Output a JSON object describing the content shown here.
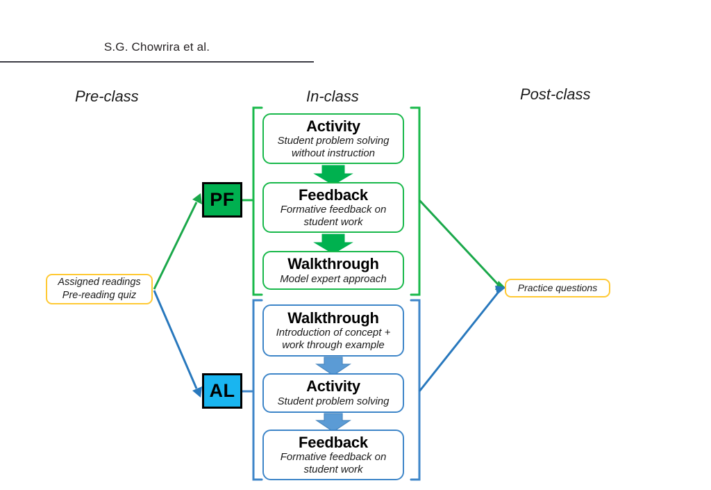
{
  "running_head": "S.G. Chowrira et al.",
  "phases": {
    "pre": "Pre-class",
    "in": "In-class",
    "post": "Post-class"
  },
  "endpoints": {
    "pre": {
      "line1": "Assigned readings",
      "line2": "Pre-reading quiz"
    },
    "post": {
      "line1": "Practice questions"
    }
  },
  "branches": [
    {
      "tag": "PF",
      "color": "#00b050",
      "line_color": "#1aa84a",
      "steps": [
        {
          "title": "Activity",
          "desc_line1": "Student problem solving",
          "desc_line2": "without instruction"
        },
        {
          "title": "Feedback",
          "desc_line1": "Formative feedback on",
          "desc_line2": "student work"
        },
        {
          "title": "Walkthrough",
          "desc_line1": "Model expert approach",
          "desc_line2": ""
        }
      ]
    },
    {
      "tag": "AL",
      "color": "#19b5f0",
      "line_color": "#2878bd",
      "steps": [
        {
          "title": "Walkthrough",
          "desc_line1": "Introduction of concept +",
          "desc_line2": "work through example"
        },
        {
          "title": "Activity",
          "desc_line1": "Student problem solving",
          "desc_line2": ""
        },
        {
          "title": "Feedback",
          "desc_line1": "Formative feedback on",
          "desc_line2": "student work"
        }
      ]
    }
  ],
  "colors": {
    "green_accent": "#18b84a",
    "green_fill": "#00b050",
    "green_line": "#1aa84a",
    "blue_accent": "#3d85c8",
    "blue_fill": "#19b5f0",
    "blue_line": "#2878bd",
    "blue_arrow": "#5b9bd5",
    "gold_border": "#ffc933",
    "rule": "#3b3b44"
  }
}
